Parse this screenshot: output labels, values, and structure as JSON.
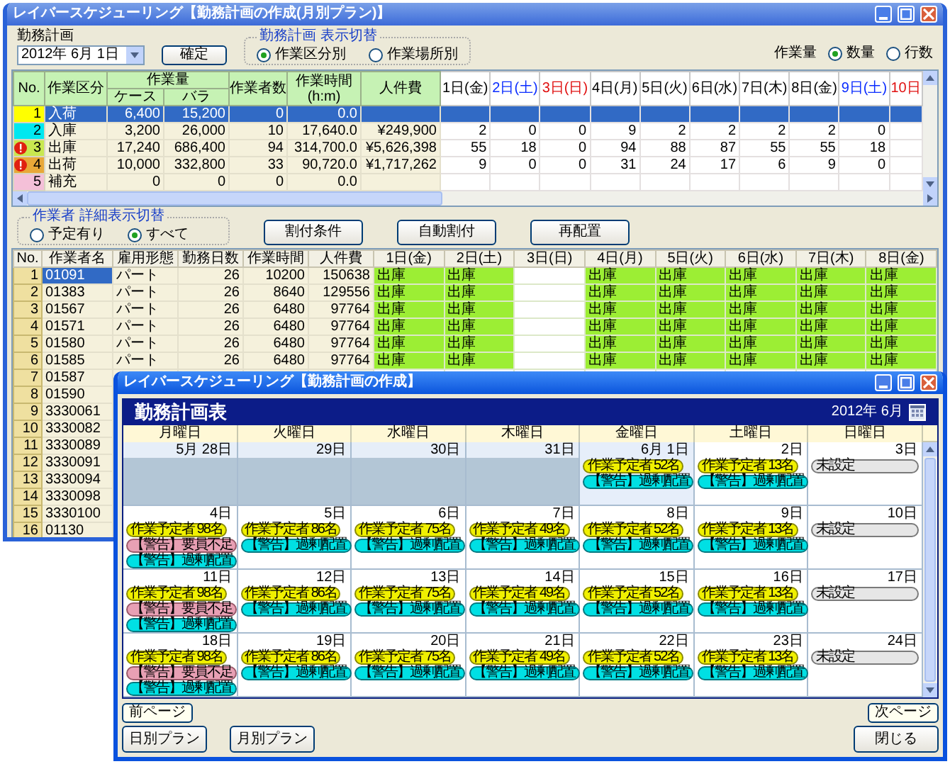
{
  "main_window": {
    "title": "レイバースケジューリング【勤務計画の作成(月別プラン)】",
    "plan": {
      "label": "勤務計画",
      "date": "2012年 6月 1日",
      "confirm_button": "確定"
    },
    "display_toggle": {
      "title": "勤務計画 表示切替",
      "options": [
        {
          "label": "作業区分別",
          "selected": true
        },
        {
          "label": "作業場所別",
          "selected": false
        }
      ]
    },
    "quantity": {
      "label": "作業量",
      "options": [
        {
          "label": "数量",
          "selected": true
        },
        {
          "label": "行数",
          "selected": false
        }
      ]
    },
    "plan_table": {
      "columns": [
        "No.",
        "作業区分",
        "作業量",
        "ケース",
        "バラ",
        "作業者数",
        "作業時間",
        "(h:m)",
        "人件費"
      ],
      "days": [
        {
          "label": "1日(金)",
          "kind": "weekday"
        },
        {
          "label": "2日(土)",
          "kind": "saturday"
        },
        {
          "label": "3日(日)",
          "kind": "sunday"
        },
        {
          "label": "4日(月)",
          "kind": "weekday"
        },
        {
          "label": "5日(火)",
          "kind": "weekday"
        },
        {
          "label": "6日(水)",
          "kind": "weekday"
        },
        {
          "label": "7日(木)",
          "kind": "weekday"
        },
        {
          "label": "8日(金)",
          "kind": "weekday"
        },
        {
          "label": "9日(土)",
          "kind": "saturday"
        },
        {
          "label": "10日",
          "kind": "sunday"
        }
      ],
      "rows": [
        {
          "no": "1",
          "color": "#ffff00",
          "warning": false,
          "selected": true,
          "category": "入荷",
          "case": "6,400",
          "piece": "15,200",
          "workers": "0",
          "hours": "0.0"
        },
        {
          "no": "2",
          "color": "#00e8f0",
          "warning": false,
          "selected": false,
          "category": "入庫",
          "case": "3,200",
          "piece": "26,000",
          "workers": "10",
          "hours": "17,640.0",
          "cost": "¥249,900",
          "days": [
            "2",
            "0",
            "0",
            "9",
            "2",
            "2",
            "2",
            "2",
            "0"
          ]
        },
        {
          "no": "3",
          "color": "#c8e850",
          "warning": true,
          "selected": false,
          "category": "出庫",
          "case": "17,240",
          "piece": "686,400",
          "workers": "94",
          "hours": "314,700.0",
          "cost": "¥5,626,398",
          "days": [
            "55",
            "18",
            "0",
            "94",
            "88",
            "87",
            "55",
            "55",
            "18"
          ]
        },
        {
          "no": "4",
          "color": "#e8a838",
          "warning": true,
          "selected": false,
          "category": "出荷",
          "case": "10,000",
          "piece": "332,800",
          "workers": "33",
          "hours": "90,720.0",
          "cost": "¥1,717,262",
          "days": [
            "9",
            "0",
            "0",
            "31",
            "24",
            "17",
            "6",
            "9",
            "0"
          ]
        },
        {
          "no": "5",
          "color": "#f4c0d8",
          "warning": false,
          "selected": false,
          "category": "補充",
          "case": "0",
          "piece": "0",
          "workers": "0",
          "hours": "0.0"
        }
      ]
    },
    "worker_toggle": {
      "title": "作業者 詳細表示切替",
      "options": [
        {
          "label": "予定有り",
          "selected": false
        },
        {
          "label": "すべて",
          "selected": true
        }
      ]
    },
    "actions": [
      "割付条件",
      "自動割付",
      "再配置"
    ],
    "worker_table": {
      "columns": [
        "No.",
        "作業者名",
        "雇用形態",
        "勤務日数",
        "作業時間",
        "人件費"
      ],
      "days": [
        "1日(金)",
        "2日(土)",
        "3日(日)",
        "4日(月)",
        "5日(火)",
        "6日(水)",
        "7日(木)",
        "8日(金)"
      ],
      "rows": [
        {
          "no": "1",
          "name": "01091",
          "selected": true,
          "type": "パート",
          "days_worked": "26",
          "hours": "10200",
          "cost": "150638",
          "shifts": [
            {
              "label": "出庫",
              "off": false
            },
            {
              "label": "出庫",
              "off": false
            },
            {
              "off": true
            },
            {
              "label": "出庫",
              "off": false
            },
            {
              "label": "出庫",
              "off": false
            },
            {
              "label": "出庫",
              "off": false
            },
            {
              "label": "出庫",
              "off": false
            },
            {
              "label": "出庫",
              "off": false
            }
          ]
        },
        {
          "no": "2",
          "name": "01383",
          "selected": false,
          "type": "パート",
          "days_worked": "26",
          "hours": "8640",
          "cost": "129556",
          "shifts": [
            {
              "label": "出庫",
              "off": false
            },
            {
              "label": "出庫",
              "off": false
            },
            {
              "off": true
            },
            {
              "label": "出庫",
              "off": false
            },
            {
              "label": "出庫",
              "off": false
            },
            {
              "label": "出庫",
              "off": false
            },
            {
              "label": "出庫",
              "off": false
            },
            {
              "label": "出庫",
              "off": false
            }
          ]
        },
        {
          "no": "3",
          "name": "01567",
          "selected": false,
          "type": "パート",
          "days_worked": "26",
          "hours": "6480",
          "cost": "97764",
          "shifts": [
            {
              "label": "出庫",
              "off": false
            },
            {
              "label": "出庫",
              "off": false
            },
            {
              "off": true
            },
            {
              "label": "出庫",
              "off": false
            },
            {
              "label": "出庫",
              "off": false
            },
            {
              "label": "出庫",
              "off": false
            },
            {
              "label": "出庫",
              "off": false
            },
            {
              "label": "出庫",
              "off": false
            }
          ]
        },
        {
          "no": "4",
          "name": "01571",
          "selected": false,
          "type": "パート",
          "days_worked": "26",
          "hours": "6480",
          "cost": "97764",
          "shifts": [
            {
              "label": "出庫",
              "off": false
            },
            {
              "label": "出庫",
              "off": false
            },
            {
              "off": true
            },
            {
              "label": "出庫",
              "off": false
            },
            {
              "label": "出庫",
              "off": false
            },
            {
              "label": "出庫",
              "off": false
            },
            {
              "label": "出庫",
              "off": false
            },
            {
              "label": "出庫",
              "off": false
            }
          ]
        },
        {
          "no": "5",
          "name": "01580",
          "selected": false,
          "type": "パート",
          "days_worked": "26",
          "hours": "6480",
          "cost": "97764",
          "shifts": [
            {
              "label": "出庫",
              "off": false
            },
            {
              "label": "出庫",
              "off": false
            },
            {
              "off": true
            },
            {
              "label": "出庫",
              "off": false
            },
            {
              "label": "出庫",
              "off": false
            },
            {
              "label": "出庫",
              "off": false
            },
            {
              "label": "出庫",
              "off": false
            },
            {
              "label": "出庫",
              "off": false
            }
          ]
        },
        {
          "no": "6",
          "name": "01585",
          "selected": false,
          "type": "パート",
          "days_worked": "26",
          "hours": "6480",
          "cost": "97764",
          "shifts": [
            {
              "label": "出庫",
              "off": false
            },
            {
              "label": "出庫",
              "off": false
            },
            {
              "off": true
            },
            {
              "label": "出庫",
              "off": false
            },
            {
              "label": "出庫",
              "off": false
            },
            {
              "label": "出庫",
              "off": false
            },
            {
              "label": "出庫",
              "off": false
            },
            {
              "label": "出庫",
              "off": false
            }
          ]
        },
        {
          "no": "7",
          "name": "01587",
          "selected": false
        },
        {
          "no": "8",
          "name": "01590",
          "selected": false
        },
        {
          "no": "9",
          "name": "3330061",
          "selected": false
        },
        {
          "no": "10",
          "name": "3330082",
          "selected": false
        },
        {
          "no": "11",
          "name": "3330089",
          "selected": false
        },
        {
          "no": "12",
          "name": "3330091",
          "selected": false
        },
        {
          "no": "13",
          "name": "3330094",
          "selected": false
        },
        {
          "no": "14",
          "name": "3330098",
          "selected": false
        },
        {
          "no": "15",
          "name": "3330100",
          "selected": false
        },
        {
          "no": "16",
          "name": "01130",
          "selected": false
        }
      ]
    }
  },
  "calendar_window": {
    "title": "レイバースケジューリング【勤務計画の作成】",
    "heading": "勤務計画表",
    "month": "2012年 6月",
    "weekdays": [
      "月曜日",
      "火曜日",
      "水曜日",
      "木曜日",
      "金曜日",
      "土曜日",
      "日曜日"
    ],
    "weeks": [
      [
        {
          "date": "5月 28日",
          "in_month": false,
          "selected": false
        },
        {
          "date": "29日",
          "in_month": false,
          "selected": false
        },
        {
          "date": "30日",
          "in_month": false,
          "selected": false
        },
        {
          "date": "31日",
          "in_month": false,
          "selected": false
        },
        {
          "date": "6月 1日",
          "in_month": true,
          "selected": true,
          "items": [
            {
              "kind": "count",
              "text": "作業予定者 52名"
            },
            {
              "kind": "excess",
              "text": "【警告】過剰配置"
            }
          ]
        },
        {
          "date": "2日",
          "in_month": true,
          "selected": false,
          "items": [
            {
              "kind": "count",
              "text": "作業予定者 13名"
            },
            {
              "kind": "excess",
              "text": "【警告】過剰配置"
            }
          ]
        },
        {
          "date": "3日",
          "in_month": true,
          "selected": false,
          "items": [
            {
              "kind": "unset",
              "text": "未設定"
            }
          ]
        }
      ],
      [
        {
          "date": "4日",
          "in_month": true,
          "selected": false,
          "items": [
            {
              "kind": "count",
              "text": "作業予定者 98名"
            },
            {
              "kind": "shortage",
              "text": "【警告】要員不足"
            },
            {
              "kind": "excess",
              "text": "【警告】過剰配置"
            }
          ]
        },
        {
          "date": "5日",
          "in_month": true,
          "selected": false,
          "items": [
            {
              "kind": "count",
              "text": "作業予定者 86名"
            },
            {
              "kind": "excess",
              "text": "【警告】過剰配置"
            }
          ]
        },
        {
          "date": "6日",
          "in_month": true,
          "selected": false,
          "items": [
            {
              "kind": "count",
              "text": "作業予定者 75名"
            },
            {
              "kind": "excess",
              "text": "【警告】過剰配置"
            }
          ]
        },
        {
          "date": "7日",
          "in_month": true,
          "selected": false,
          "items": [
            {
              "kind": "count",
              "text": "作業予定者 49名"
            },
            {
              "kind": "excess",
              "text": "【警告】過剰配置"
            }
          ]
        },
        {
          "date": "8日",
          "in_month": true,
          "selected": false,
          "items": [
            {
              "kind": "count",
              "text": "作業予定者 52名"
            },
            {
              "kind": "excess",
              "text": "【警告】過剰配置"
            }
          ]
        },
        {
          "date": "9日",
          "in_month": true,
          "selected": false,
          "items": [
            {
              "kind": "count",
              "text": "作業予定者 13名"
            },
            {
              "kind": "excess",
              "text": "【警告】過剰配置"
            }
          ]
        },
        {
          "date": "10日",
          "in_month": true,
          "selected": false,
          "items": [
            {
              "kind": "unset",
              "text": "未設定"
            }
          ]
        }
      ],
      [
        {
          "date": "11日",
          "in_month": true,
          "selected": false,
          "items": [
            {
              "kind": "count",
              "text": "作業予定者 98名"
            },
            {
              "kind": "shortage",
              "text": "【警告】要員不足"
            },
            {
              "kind": "excess",
              "text": "【警告】過剰配置"
            }
          ]
        },
        {
          "date": "12日",
          "in_month": true,
          "selected": false,
          "items": [
            {
              "kind": "count",
              "text": "作業予定者 86名"
            },
            {
              "kind": "excess",
              "text": "【警告】過剰配置"
            }
          ]
        },
        {
          "date": "13日",
          "in_month": true,
          "selected": false,
          "items": [
            {
              "kind": "count",
              "text": "作業予定者 75名"
            },
            {
              "kind": "excess",
              "text": "【警告】過剰配置"
            }
          ]
        },
        {
          "date": "14日",
          "in_month": true,
          "selected": false,
          "items": [
            {
              "kind": "count",
              "text": "作業予定者 49名"
            },
            {
              "kind": "excess",
              "text": "【警告】過剰配置"
            }
          ]
        },
        {
          "date": "15日",
          "in_month": true,
          "selected": false,
          "items": [
            {
              "kind": "count",
              "text": "作業予定者 52名"
            },
            {
              "kind": "excess",
              "text": "【警告】過剰配置"
            }
          ]
        },
        {
          "date": "16日",
          "in_month": true,
          "selected": false,
          "items": [
            {
              "kind": "count",
              "text": "作業予定者 13名"
            },
            {
              "kind": "excess",
              "text": "【警告】過剰配置"
            }
          ]
        },
        {
          "date": "17日",
          "in_month": true,
          "selected": false,
          "items": [
            {
              "kind": "unset",
              "text": "未設定"
            }
          ]
        }
      ],
      [
        {
          "date": "18日",
          "in_month": true,
          "selected": false,
          "items": [
            {
              "kind": "count",
              "text": "作業予定者 98名"
            },
            {
              "kind": "shortage",
              "text": "【警告】要員不足"
            },
            {
              "kind": "excess",
              "text": "【警告】過剰配置"
            }
          ]
        },
        {
          "date": "19日",
          "in_month": true,
          "selected": false,
          "items": [
            {
              "kind": "count",
              "text": "作業予定者 86名"
            },
            {
              "kind": "excess",
              "text": "【警告】過剰配置"
            }
          ]
        },
        {
          "date": "20日",
          "in_month": true,
          "selected": false,
          "items": [
            {
              "kind": "count",
              "text": "作業予定者 75名"
            },
            {
              "kind": "excess",
              "text": "【警告】過剰配置"
            }
          ]
        },
        {
          "date": "21日",
          "in_month": true,
          "selected": false,
          "items": [
            {
              "kind": "count",
              "text": "作業予定者 49名"
            },
            {
              "kind": "excess",
              "text": "【警告】過剰配置"
            }
          ]
        },
        {
          "date": "22日",
          "in_month": true,
          "selected": false,
          "items": [
            {
              "kind": "count",
              "text": "作業予定者 52名"
            },
            {
              "kind": "excess",
              "text": "【警告】過剰配置"
            }
          ]
        },
        {
          "date": "23日",
          "in_month": true,
          "selected": false,
          "items": [
            {
              "kind": "count",
              "text": "作業予定者 13名"
            },
            {
              "kind": "excess",
              "text": "【警告】過剰配置"
            }
          ]
        },
        {
          "date": "24日",
          "in_month": true,
          "selected": false,
          "items": [
            {
              "kind": "unset",
              "text": "未設定"
            }
          ]
        }
      ]
    ],
    "prev_button": "前ページ",
    "next_button": "次ページ",
    "plan_buttons": [
      "日別プラン",
      "月別プラン"
    ],
    "close_button": "閉じる"
  }
}
